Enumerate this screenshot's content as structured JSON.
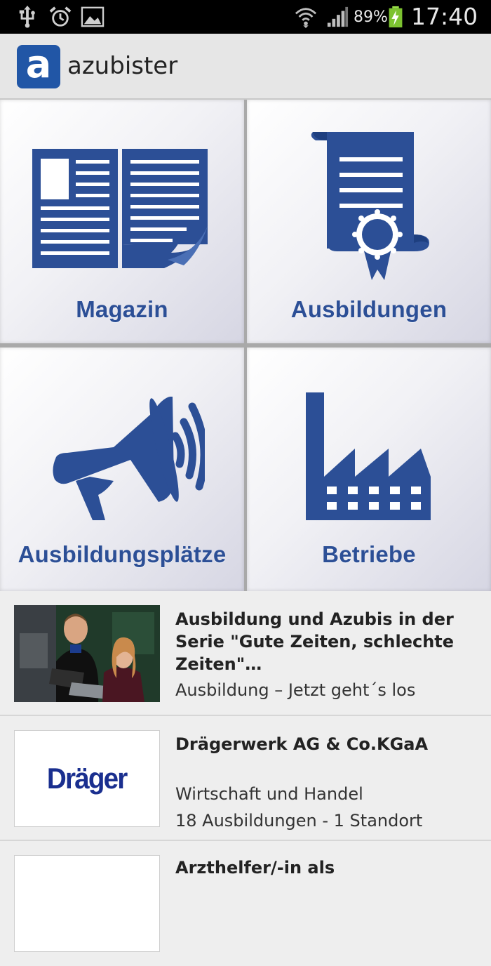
{
  "status_bar": {
    "battery_percent": "89%",
    "time": "17:40",
    "icons": [
      "usb-icon",
      "alarm-icon",
      "image-icon",
      "wifi-icon",
      "signal-icon",
      "battery-charging-icon"
    ]
  },
  "app_bar": {
    "logo_letter": "a",
    "title": "azubister",
    "brand_color": "#2156a6"
  },
  "tiles": [
    {
      "label": "Magazin",
      "icon": "newspaper-icon"
    },
    {
      "label": "Ausbildungen",
      "icon": "certificate-icon"
    },
    {
      "label": "Ausbildungsplätze",
      "icon": "megaphone-icon"
    },
    {
      "label": "Betriebe",
      "icon": "factory-icon"
    }
  ],
  "tile_color": "#2c4f96",
  "news": [
    {
      "title": "Ausbildung und Azubis in der Serie \"Gute Zeiten, schlechte Zeiten\"…",
      "subtitle": "Ausbildung – Jetzt geht´s los",
      "thumbnail": "photo-people-thumbnail"
    },
    {
      "title": "Drägerwerk AG & Co.KGaA",
      "category": "Wirtschaft und Handel",
      "details": "18 Ausbildungen - 1 Standort",
      "logo_text": "Dräger",
      "thumbnail": "draeger-logo"
    },
    {
      "title": "Arzthelfer/-in als"
    }
  ]
}
